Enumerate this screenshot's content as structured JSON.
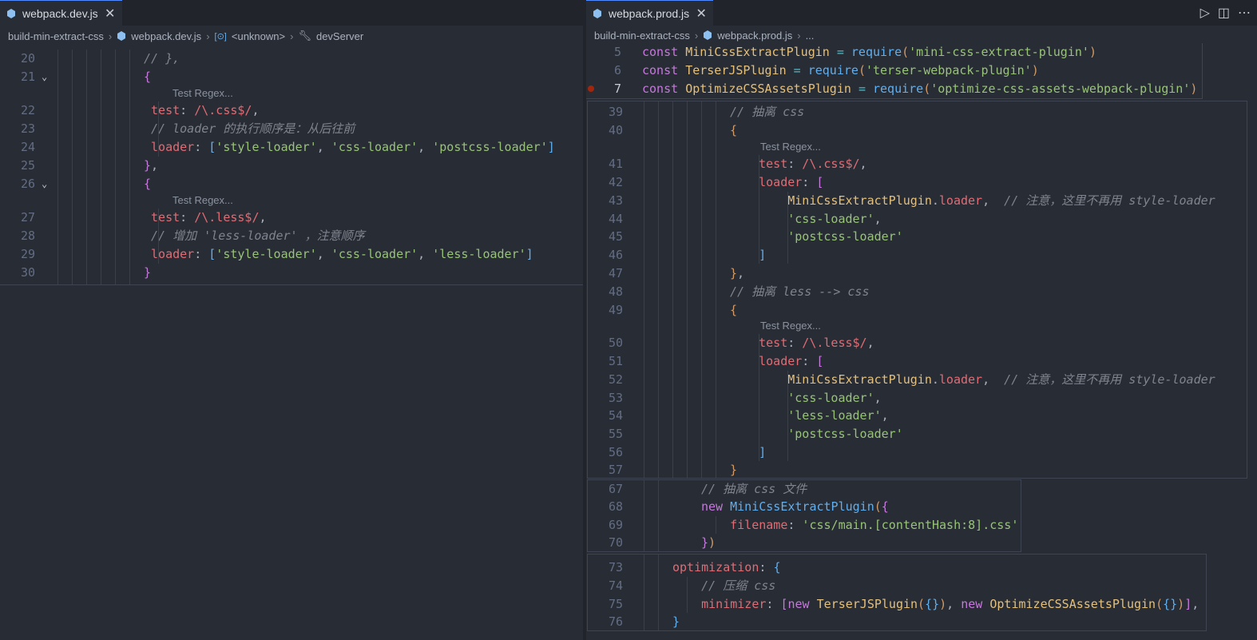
{
  "left": {
    "tab_label": "webpack.dev.js",
    "breadcrumb": [
      "build-min-extract-css",
      "webpack.dev.js",
      "<unknown>",
      "devServer"
    ],
    "codelens": "Test Regex...",
    "lines": [
      {
        "n": "20",
        "tokens": [
          [
            "cm",
            "// },"
          ]
        ]
      },
      {
        "n": "21",
        "tokens": [
          [
            "b2",
            "{"
          ]
        ]
      },
      {
        "n": "22",
        "tokens": [
          [
            "p",
            "test"
          ],
          [
            "t",
            ": "
          ],
          [
            "p",
            "/\\.css$/"
          ],
          [
            "t",
            ","
          ]
        ]
      },
      {
        "n": "23",
        "tokens": [
          [
            "cm",
            "// loader 的执行顺序是：从后往前"
          ]
        ]
      },
      {
        "n": "24",
        "tokens": [
          [
            "p",
            "loader"
          ],
          [
            "t",
            ": "
          ],
          [
            "b3",
            "["
          ],
          [
            "s",
            "'style-loader'"
          ],
          [
            "t",
            ", "
          ],
          [
            "s",
            "'css-loader'"
          ],
          [
            "t",
            ", "
          ],
          [
            "s",
            "'postcss-loader'"
          ],
          [
            "b3",
            "]"
          ]
        ]
      },
      {
        "n": "25",
        "tokens": [
          [
            "b2",
            "}"
          ],
          [
            "t",
            ","
          ]
        ]
      },
      {
        "n": "26",
        "tokens": [
          [
            "b2",
            "{"
          ]
        ]
      },
      {
        "n": "27",
        "tokens": [
          [
            "p",
            "test"
          ],
          [
            "t",
            ": "
          ],
          [
            "p",
            "/\\.less$/"
          ],
          [
            "t",
            ","
          ]
        ]
      },
      {
        "n": "28",
        "tokens": [
          [
            "cm",
            "// 增加 'less-loader' ，注意顺序"
          ]
        ]
      },
      {
        "n": "29",
        "tokens": [
          [
            "p",
            "loader"
          ],
          [
            "t",
            ": "
          ],
          [
            "b3",
            "["
          ],
          [
            "s",
            "'style-loader'"
          ],
          [
            "t",
            ", "
          ],
          [
            "s",
            "'css-loader'"
          ],
          [
            "t",
            ", "
          ],
          [
            "s",
            "'less-loader'"
          ],
          [
            "b3",
            "]"
          ]
        ]
      },
      {
        "n": "30",
        "tokens": [
          [
            "b2",
            "}"
          ]
        ]
      }
    ]
  },
  "right": {
    "tab_label": "webpack.prod.js",
    "breadcrumb": [
      "build-min-extract-css",
      "webpack.prod.js",
      "..."
    ],
    "codelens": "Test Regex...",
    "sticky_lines": [
      {
        "n": "5",
        "tokens": [
          [
            "k",
            "const "
          ],
          [
            "c",
            "MiniCssExtractPlugin"
          ],
          [
            "t",
            " "
          ],
          [
            "o",
            "="
          ],
          [
            "t",
            " "
          ],
          [
            "f",
            "require"
          ],
          [
            "b1",
            "("
          ],
          [
            "s",
            "'mini-css-extract-plugin'"
          ],
          [
            "b1",
            ")"
          ]
        ]
      },
      {
        "n": "6",
        "tokens": [
          [
            "k",
            "const "
          ],
          [
            "c",
            "TerserJSPlugin"
          ],
          [
            "t",
            " "
          ],
          [
            "o",
            "="
          ],
          [
            "t",
            " "
          ],
          [
            "f",
            "require"
          ],
          [
            "b1",
            "("
          ],
          [
            "s",
            "'terser-webpack-plugin'"
          ],
          [
            "b1",
            ")"
          ]
        ]
      },
      {
        "n": "7",
        "tokens": [
          [
            "k",
            "const "
          ],
          [
            "c",
            "OptimizeCSSAssetsPlugin"
          ],
          [
            "t",
            " "
          ],
          [
            "o",
            "="
          ],
          [
            "t",
            " "
          ],
          [
            "f",
            "require"
          ],
          [
            "b1",
            "("
          ],
          [
            "s",
            "'optimize-css-assets-webpack-plugin'"
          ],
          [
            "b1",
            ")"
          ]
        ]
      }
    ],
    "block1": [
      {
        "n": "39",
        "tokens": [
          [
            "cm",
            "// 抽离 css"
          ]
        ]
      },
      {
        "n": "40",
        "tokens": [
          [
            "b1",
            "{"
          ]
        ]
      },
      {
        "n": "41",
        "tokens": [
          [
            "p",
            "test"
          ],
          [
            "t",
            ": "
          ],
          [
            "p",
            "/\\.css$/"
          ],
          [
            "t",
            ","
          ]
        ]
      },
      {
        "n": "42",
        "tokens": [
          [
            "p",
            "loader"
          ],
          [
            "t",
            ": "
          ],
          [
            "b2",
            "["
          ]
        ]
      },
      {
        "n": "43",
        "tokens": [
          [
            "c",
            "MiniCssExtractPlugin"
          ],
          [
            "t",
            "."
          ],
          [
            "p",
            "loader"
          ],
          [
            "t",
            ",  "
          ],
          [
            "cm",
            "// 注意，这里不再用 style-loader"
          ]
        ]
      },
      {
        "n": "44",
        "tokens": [
          [
            "s",
            "'css-loader'"
          ],
          [
            "t",
            ","
          ]
        ]
      },
      {
        "n": "45",
        "tokens": [
          [
            "s",
            "'postcss-loader'"
          ]
        ]
      },
      {
        "n": "46",
        "tokens": [
          [
            "b3",
            "]"
          ]
        ]
      },
      {
        "n": "47",
        "tokens": [
          [
            "b1",
            "}"
          ],
          [
            "t",
            ","
          ]
        ]
      },
      {
        "n": "48",
        "tokens": [
          [
            "cm",
            "// 抽离 less --> css"
          ]
        ]
      },
      {
        "n": "49",
        "tokens": [
          [
            "b1",
            "{"
          ]
        ]
      },
      {
        "n": "50",
        "tokens": [
          [
            "p",
            "test"
          ],
          [
            "t",
            ": "
          ],
          [
            "p",
            "/\\.less$/"
          ],
          [
            "t",
            ","
          ]
        ]
      },
      {
        "n": "51",
        "tokens": [
          [
            "p",
            "loader"
          ],
          [
            "t",
            ": "
          ],
          [
            "b2",
            "["
          ]
        ]
      },
      {
        "n": "52",
        "tokens": [
          [
            "c",
            "MiniCssExtractPlugin"
          ],
          [
            "t",
            "."
          ],
          [
            "p",
            "loader"
          ],
          [
            "t",
            ",  "
          ],
          [
            "cm",
            "// 注意，这里不再用 style-loader"
          ]
        ]
      },
      {
        "n": "53",
        "tokens": [
          [
            "s",
            "'css-loader'"
          ],
          [
            "t",
            ","
          ]
        ]
      },
      {
        "n": "54",
        "tokens": [
          [
            "s",
            "'less-loader'"
          ],
          [
            "t",
            ","
          ]
        ]
      },
      {
        "n": "55",
        "tokens": [
          [
            "s",
            "'postcss-loader'"
          ]
        ]
      },
      {
        "n": "56",
        "tokens": [
          [
            "b3",
            "]"
          ]
        ]
      },
      {
        "n": "57",
        "tokens": [
          [
            "b1",
            "}"
          ]
        ]
      }
    ],
    "block2": [
      {
        "n": "67",
        "tokens": [
          [
            "cm",
            "// 抽离 css 文件"
          ]
        ]
      },
      {
        "n": "68",
        "tokens": [
          [
            "k",
            "new "
          ],
          [
            "f",
            "MiniCssExtractPlugin"
          ],
          [
            "b1",
            "("
          ],
          [
            "b2",
            "{"
          ]
        ]
      },
      {
        "n": "69",
        "tokens": [
          [
            "p",
            "filename"
          ],
          [
            "t",
            ": "
          ],
          [
            "s",
            "'css/main.[contentHash:8].css'"
          ]
        ]
      },
      {
        "n": "70",
        "tokens": [
          [
            "b2",
            "}"
          ],
          [
            "b1",
            ")"
          ]
        ]
      }
    ],
    "block3": [
      {
        "n": "73",
        "tokens": [
          [
            "p",
            "optimization"
          ],
          [
            "t",
            ": "
          ],
          [
            "b3",
            "{"
          ]
        ]
      },
      {
        "n": "74",
        "tokens": [
          [
            "cm",
            "// 压缩 css"
          ]
        ]
      },
      {
        "n": "75",
        "tokens": [
          [
            "p",
            "minimizer"
          ],
          [
            "t",
            ": "
          ],
          [
            "b2",
            "["
          ],
          [
            "k",
            "new "
          ],
          [
            "c",
            "TerserJSPlugin"
          ],
          [
            "b1",
            "("
          ],
          [
            "b3",
            "{}"
          ],
          [
            "b1",
            ")"
          ],
          [
            "t",
            ", "
          ],
          [
            "k",
            "new "
          ],
          [
            "c",
            "OptimizeCSSAssetsPlugin"
          ],
          [
            "b1",
            "("
          ],
          [
            "b3",
            "{}"
          ],
          [
            "b1",
            ")"
          ],
          [
            "b2",
            "]"
          ],
          [
            "t",
            ","
          ]
        ]
      },
      {
        "n": "76",
        "tokens": [
          [
            "b3",
            "}"
          ]
        ]
      }
    ]
  }
}
